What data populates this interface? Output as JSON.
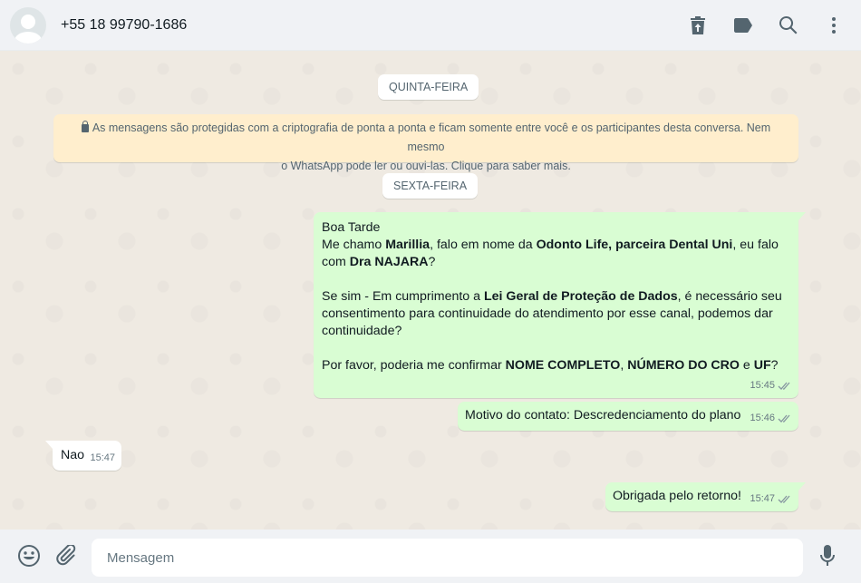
{
  "header": {
    "contact_name": "+55 18 99790-1686",
    "icons": [
      "delete-icon",
      "label-icon",
      "search-icon",
      "menu-icon"
    ]
  },
  "chat": {
    "date_chips": [
      "QUINTA-FEIRA",
      "SEXTA-FEIRA"
    ],
    "system_message_line1": "As mensagens são protegidas com a criptografia de ponta a ponta e ficam somente entre você e os participantes desta conversa. Nem mesmo",
    "system_message_line2": "o WhatsApp pode ler ou ouvi-las. Clique para saber mais.",
    "messages": [
      {
        "direction": "out",
        "time": "15:45",
        "lines": {
          "l1": "Boa Tarde",
          "l2_a": "Me chamo ",
          "l2_b": "Marillia",
          "l2_c": ", falo em nome da ",
          "l2_d": "Odonto Life, parceira Dental Uni",
          "l2_e": ", eu falo",
          "l3_a": "com ",
          "l3_b": "Dra NAJARA",
          "l3_c": "?",
          "l5_a": "Se sim - Em cumprimento a ",
          "l5_b": "Lei Geral de Proteção de Dados",
          "l5_c": ", é necessário seu",
          "l6": "consentimento para continuidade do atendimento por esse canal, podemos dar",
          "l7": "continuidade?",
          "l9_a": "Por favor, poderia me confirmar ",
          "l9_b": "NOME COMPLETO",
          "l9_c": ", ",
          "l9_d": "NÚMERO DO CRO",
          "l9_e": " e ",
          "l9_f": "UF",
          "l9_g": "?"
        }
      },
      {
        "direction": "out",
        "time": "15:46",
        "text": "Motivo do contato: Descredenciamento do plano"
      },
      {
        "direction": "in",
        "time": "15:47",
        "text": "Nao"
      },
      {
        "direction": "out",
        "time": "15:47",
        "text": "Obrigada pelo retorno!"
      }
    ]
  },
  "footer": {
    "input_placeholder": "Mensagem",
    "icons": [
      "emoji-icon",
      "attach-icon",
      "microphone-icon"
    ]
  },
  "colors": {
    "outgoing_bubble": "#d9fdd3",
    "incoming_bubble": "#ffffff",
    "system_bubble": "#ffeecd",
    "chat_background": "#efeae2",
    "read_ticks": "#8696a0"
  }
}
